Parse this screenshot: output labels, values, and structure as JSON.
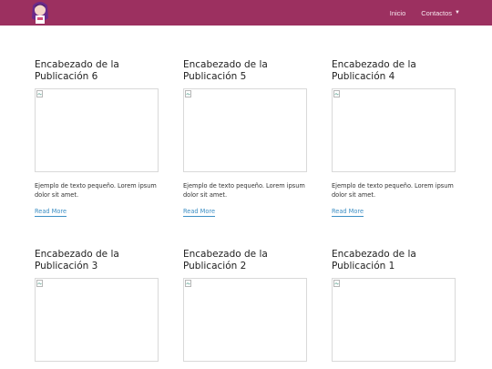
{
  "navbar": {
    "logo_alt": "avatar logo",
    "links": [
      {
        "label": "Inicio"
      },
      {
        "label": "Contactos",
        "caret": "▼"
      }
    ],
    "bg_color": "#9c3060"
  },
  "posts": [
    {
      "title": "Encabezado de la Publicación 6",
      "text": "Ejemplo de texto pequeño. Lorem ipsum dolor sit amet.",
      "link": "Read More"
    },
    {
      "title": "Encabezado de la Publicación 5",
      "text": "Ejemplo de texto pequeño. Lorem ipsum dolor sit amet.",
      "link": "Read More"
    },
    {
      "title": "Encabezado de la Publicación 4",
      "text": "Ejemplo de texto pequeño. Lorem ipsum dolor sit amet.",
      "link": "Read More"
    },
    {
      "title": "Encabezado de la Publicación 3",
      "text": "",
      "link": ""
    },
    {
      "title": "Encabezado de la Publicación 2",
      "text": "",
      "link": ""
    },
    {
      "title": "Encabezado de la Publicación 1",
      "text": "",
      "link": ""
    }
  ],
  "colors": {
    "link": "#3d8fc4"
  }
}
